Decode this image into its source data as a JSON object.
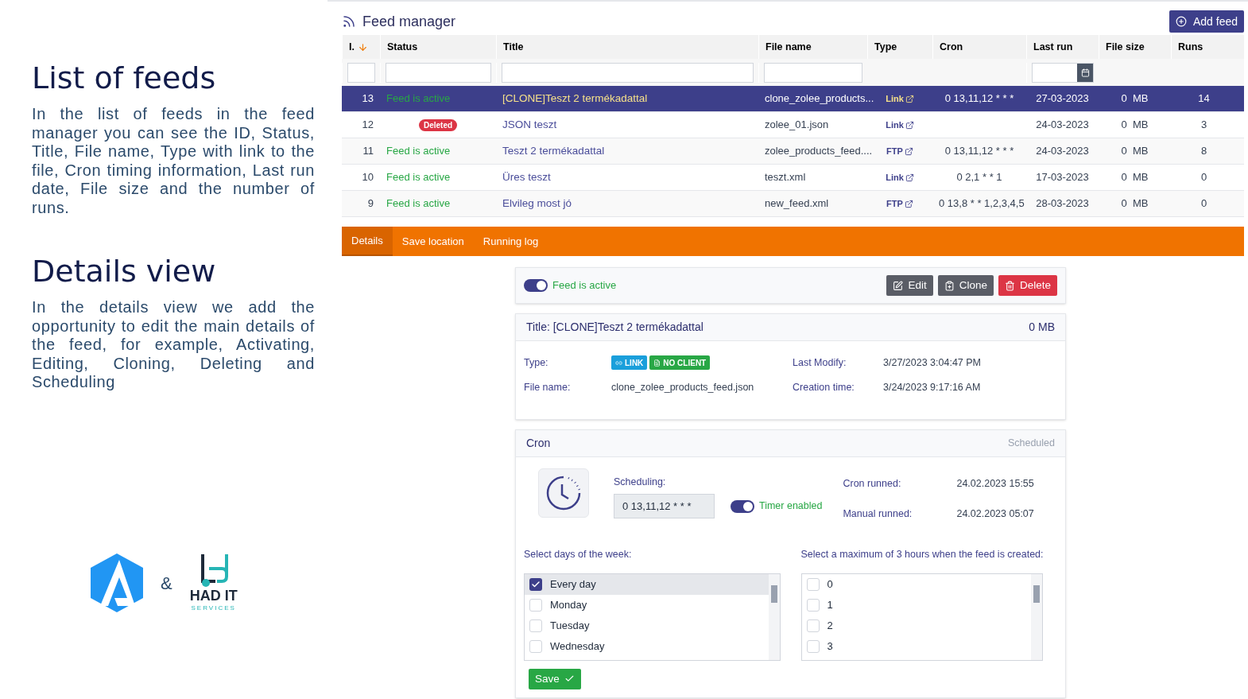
{
  "slide": {
    "sections": [
      {
        "heading": "List of feeds",
        "body": "In the list of feeds in the feed manager you can see the ID, Status, Title, File name, Type with link to the file, Cron timing information, Last run date, File size and the number of runs."
      },
      {
        "heading": "Details view",
        "body": "In the details view we add the opportunity to edit the main details of the feed, for example, Activating, Editing, Cloning, Deleting and Scheduling"
      }
    ],
    "joiner": "&",
    "partner": {
      "name": "HAD IT",
      "tagline": "SERVICES"
    }
  },
  "app": {
    "title": "Feed manager",
    "add_button": "Add feed",
    "columns": [
      {
        "label": "I.",
        "sorted": true,
        "kind": "text"
      },
      {
        "label": "Status",
        "sorted": false,
        "kind": "text"
      },
      {
        "label": "Title",
        "sorted": false,
        "kind": "text"
      },
      {
        "label": "File name",
        "sorted": false,
        "kind": "text"
      },
      {
        "label": "Type",
        "sorted": false,
        "kind": "plain"
      },
      {
        "label": "Cron",
        "sorted": false,
        "kind": "plain"
      },
      {
        "label": "Last run",
        "sorted": false,
        "kind": "date"
      },
      {
        "label": "File size",
        "sorted": false,
        "kind": "plain"
      },
      {
        "label": "Runs",
        "sorted": false,
        "kind": "plain"
      }
    ],
    "rows": [
      {
        "id": "13",
        "status": {
          "kind": "active",
          "label": "Feed is active"
        },
        "title": "[CLONE]Teszt 2 termékadattal",
        "file_name": "clone_zolee_products...",
        "type": "Link",
        "cron": "0 13,11,12 * * *",
        "last_run": "27-03-2023",
        "size": "0",
        "unit": "MB",
        "runs": "14",
        "selected": true
      },
      {
        "id": "12",
        "status": {
          "kind": "deleted",
          "label": "Deleted"
        },
        "title": "JSON teszt",
        "file_name": "zolee_01.json",
        "type": "Link",
        "last_run": "24-03-2023",
        "size": "0",
        "unit": "MB",
        "runs": "3",
        "selected": false
      },
      {
        "id": "11",
        "status": {
          "kind": "active",
          "label": "Feed is active"
        },
        "title": "Teszt 2 termékadattal",
        "file_name": "zolee_products_feed....",
        "type": "FTP",
        "cron": "0 13,11,12 * * *",
        "last_run": "24-03-2023",
        "size": "0",
        "unit": "MB",
        "runs": "8",
        "selected": false
      },
      {
        "id": "10",
        "status": {
          "kind": "active",
          "label": "Feed is active"
        },
        "title": "Üres teszt",
        "file_name": "teszt.xml",
        "type": "Link",
        "cron": "0 2,1 * * 1",
        "last_run": "17-03-2023",
        "size": "0",
        "unit": "MB",
        "runs": "0",
        "selected": false
      },
      {
        "id": "9",
        "status": {
          "kind": "active",
          "label": "Feed is active"
        },
        "title": "Elvileg most jó",
        "file_name": "new_feed.xml",
        "type": "FTP",
        "cron": "0 13,8 * * 1,2,3,4,5",
        "last_run": "28-03-2023",
        "size": "0",
        "unit": "MB",
        "runs": "0",
        "selected": false
      }
    ],
    "tabs": [
      {
        "label": "Details",
        "selected": true
      },
      {
        "label": "Save location",
        "selected": false
      },
      {
        "label": "Running log",
        "selected": false
      }
    ],
    "details": {
      "active": {
        "on": true,
        "label": "Feed is active"
      },
      "actions": [
        {
          "label": "Edit",
          "kind": "edit"
        },
        {
          "label": "Clone",
          "kind": "clone"
        },
        {
          "label": "Delete",
          "kind": "delete"
        }
      ],
      "title": "Title: [CLONE]Teszt 2 termékadattal",
      "size": "0 MB",
      "type_label": "Type:",
      "badges": [
        {
          "label": "LINK",
          "kind": "link",
          "color": "#1a9fdb"
        },
        {
          "label": "NO CLIENT",
          "kind": "client",
          "color": "#28a745"
        }
      ],
      "file_label": "File name:",
      "file_value": "clone_zolee_products_feed.json",
      "modify_label": "Last Modify:",
      "modify_value": "3/27/2023 3:04:47 PM",
      "creation_label": "Creation time:",
      "creation_value": "3/24/2023 9:17:16 AM"
    },
    "cron": {
      "heading": "Cron",
      "status": "Scheduled",
      "scheduling_label": "Scheduling:",
      "scheduling_value": "0 13,11,12 * * *",
      "timer": {
        "on": true,
        "label": "Timer enabled"
      },
      "cron_label": "Cron runned:",
      "cron_value": "24.02.2023 15:55",
      "manual_label": "Manual runned:",
      "manual_value": "24.02.2023 05:07",
      "days_label": "Select days of the week:",
      "days": [
        {
          "label": "Every day",
          "checked": true
        },
        {
          "label": "Monday",
          "checked": false
        },
        {
          "label": "Tuesday",
          "checked": false
        },
        {
          "label": "Wednesday",
          "checked": false
        }
      ],
      "hours_label": "Select a maximum of 3 hours when the feed is created:",
      "hours": [
        {
          "label": "0",
          "checked": false
        },
        {
          "label": "1",
          "checked": false
        },
        {
          "label": "2",
          "checked": false
        },
        {
          "label": "3",
          "checked": false
        }
      ],
      "save": "Save"
    }
  }
}
